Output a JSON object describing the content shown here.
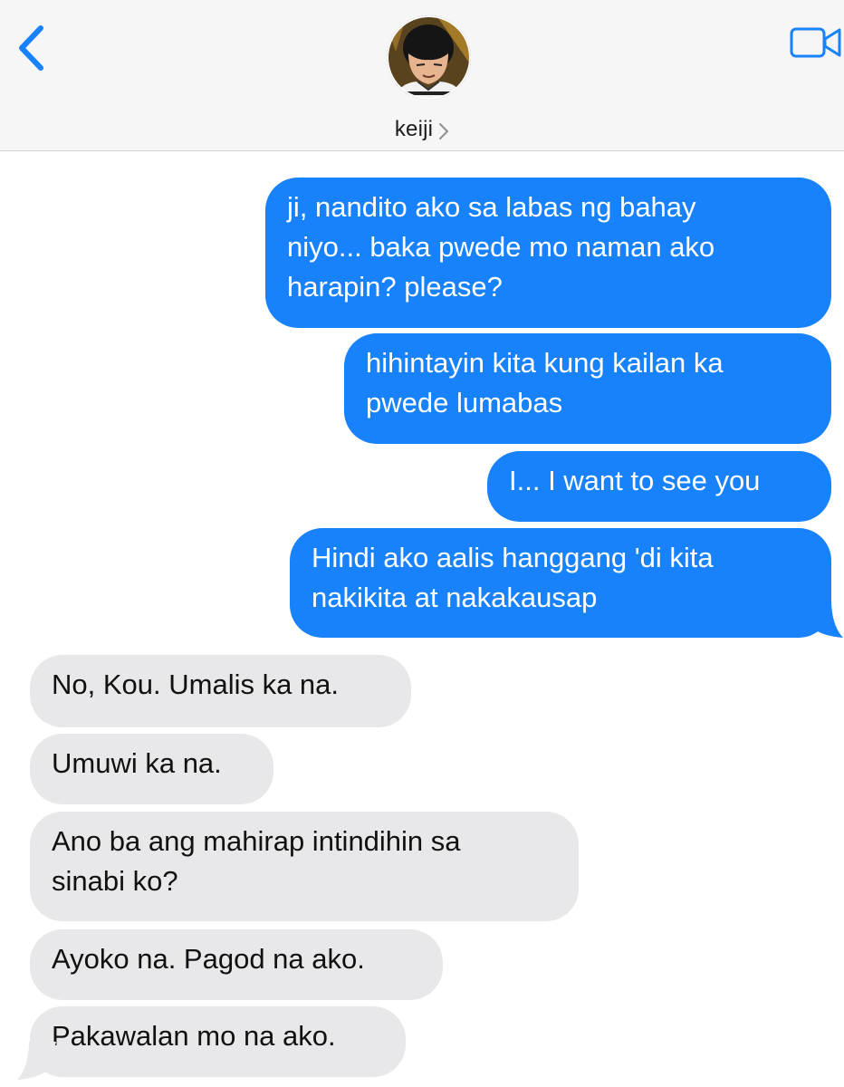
{
  "header": {
    "back_icon": "chevron-left-icon",
    "contact_name": "keiji",
    "contact_chevron": ">",
    "video_icon": "video-camera-icon",
    "accent_color": "#1782fb"
  },
  "messages": [
    {
      "direction": "sent",
      "text": "ji, nandito ako sa labas ng bahay\nniyo... baka pwede mo naman ako\nharapin? please?"
    },
    {
      "direction": "sent",
      "text": "hihintayin kita kung kailan ka\npwede lumabas"
    },
    {
      "direction": "sent",
      "text": "I... I want to see you"
    },
    {
      "direction": "sent",
      "text": "Hindi ako aalis hanggang 'di kita\nnakikita at nakakausap"
    },
    {
      "direction": "received",
      "text": "No, Kou. Umalis ka na."
    },
    {
      "direction": "received",
      "text": "Umuwi ka na."
    },
    {
      "direction": "received",
      "text": "Ano ba ang mahirap intindihin sa\nsinabi ko?"
    },
    {
      "direction": "received",
      "text": "Ayoko na. Pagod na ako."
    },
    {
      "direction": "received",
      "text": "Pakawalan mo na ako."
    }
  ],
  "colors": {
    "sent_bubble": "#1782fb",
    "received_bubble": "#e8e8ea",
    "header_bg": "#f6f6f6"
  }
}
